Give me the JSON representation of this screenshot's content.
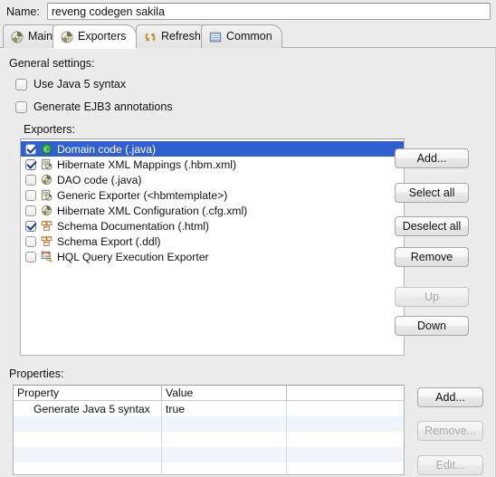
{
  "name_field": {
    "label": "Name:",
    "value": "reveng codegen sakila"
  },
  "tabs": [
    {
      "label": "Main",
      "icon": "hibernate-icon",
      "active": false
    },
    {
      "label": "Exporters",
      "icon": "hibernate-icon",
      "active": true
    },
    {
      "label": "Refresh",
      "icon": "refresh-icon",
      "active": false
    },
    {
      "label": "Common",
      "icon": "common-icon",
      "active": false
    }
  ],
  "general_settings": {
    "label": "General settings:",
    "checkboxes": [
      {
        "label": "Use Java 5 syntax",
        "checked": false
      },
      {
        "label": "Generate EJB3 annotations",
        "checked": false
      }
    ]
  },
  "exporters": {
    "label": "Exporters:",
    "items": [
      {
        "label": "Domain code (.java)",
        "checked": true,
        "selected": true,
        "icon": "java-class-icon"
      },
      {
        "label": "Hibernate XML Mappings (.hbm.xml)",
        "checked": true,
        "selected": false,
        "icon": "xml-mapping-icon"
      },
      {
        "label": "DAO code (.java)",
        "checked": false,
        "selected": false,
        "icon": "hibernate-icon"
      },
      {
        "label": "Generic Exporter (<hbmtemplate>)",
        "checked": false,
        "selected": false,
        "icon": "xml-mapping-icon"
      },
      {
        "label": "Hibernate XML Configuration (.cfg.xml)",
        "checked": false,
        "selected": false,
        "icon": "hibernate-icon"
      },
      {
        "label": "Schema Documentation (.html)",
        "checked": true,
        "selected": false,
        "icon": "schema-doc-icon"
      },
      {
        "label": "Schema Export (.ddl)",
        "checked": false,
        "selected": false,
        "icon": "schema-doc-icon"
      },
      {
        "label": "HQL Query Execution Exporter",
        "checked": false,
        "selected": false,
        "icon": "hql-query-icon"
      }
    ],
    "buttons": [
      {
        "label": "Add...",
        "enabled": true
      },
      {
        "label": "Select all",
        "enabled": true
      },
      {
        "label": "Deselect all",
        "enabled": true
      },
      {
        "label": "Remove",
        "enabled": true
      },
      {
        "label": "Up",
        "enabled": false
      },
      {
        "label": "Down",
        "enabled": true
      }
    ]
  },
  "properties": {
    "label": "Properties:",
    "columns": [
      "Property",
      "Value",
      ""
    ],
    "rows": [
      [
        "Generate Java 5 syntax",
        "true",
        ""
      ]
    ],
    "buttons": [
      {
        "label": "Add...",
        "enabled": true
      },
      {
        "label": "Remove...",
        "enabled": false
      },
      {
        "label": "Edit...",
        "enabled": false
      }
    ]
  },
  "colors": {
    "selection": "#2f5fd0",
    "window_bg": "#ececec",
    "field_bg": "#ffffff",
    "alt_row": "#f0f4fb"
  }
}
